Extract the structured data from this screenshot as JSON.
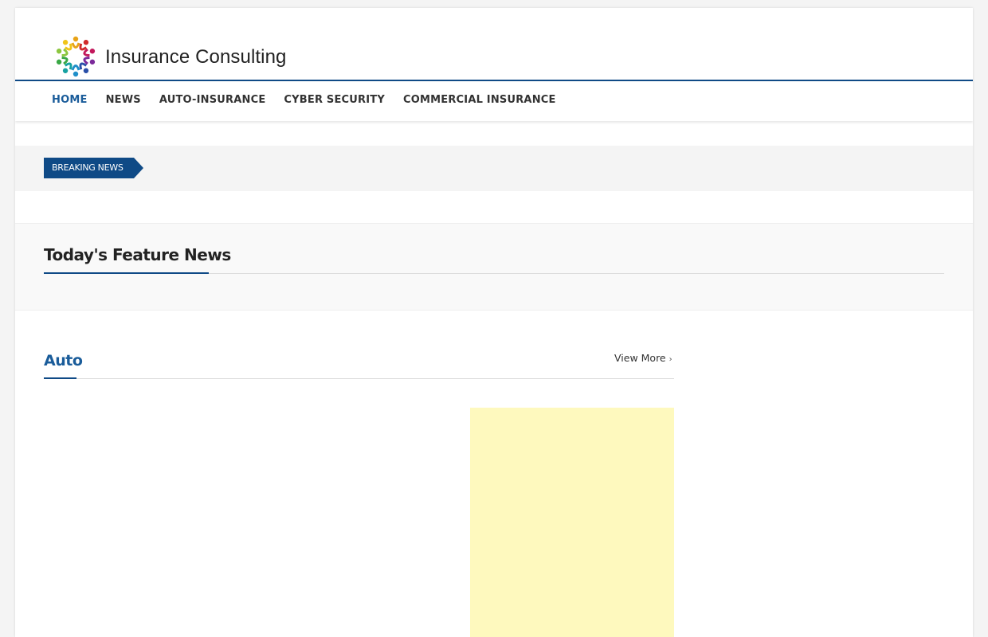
{
  "site": {
    "brand": "Insurance Consulting"
  },
  "nav": {
    "items": [
      {
        "label": "HOME",
        "active": true
      },
      {
        "label": "NEWS"
      },
      {
        "label": "AUTO-INSURANCE"
      },
      {
        "label": "CYBER SECURITY"
      },
      {
        "label": "COMMERCIAL INSURANCE"
      }
    ]
  },
  "breaking": {
    "label": "BREAKING NEWS"
  },
  "feature": {
    "title": "Today's Feature News"
  },
  "section": {
    "title": "Auto",
    "view_more": "View More"
  },
  "colors": {
    "accent": "#0f4a86",
    "link_active": "#1a5c9a",
    "ad_fill": "#fef9be"
  }
}
